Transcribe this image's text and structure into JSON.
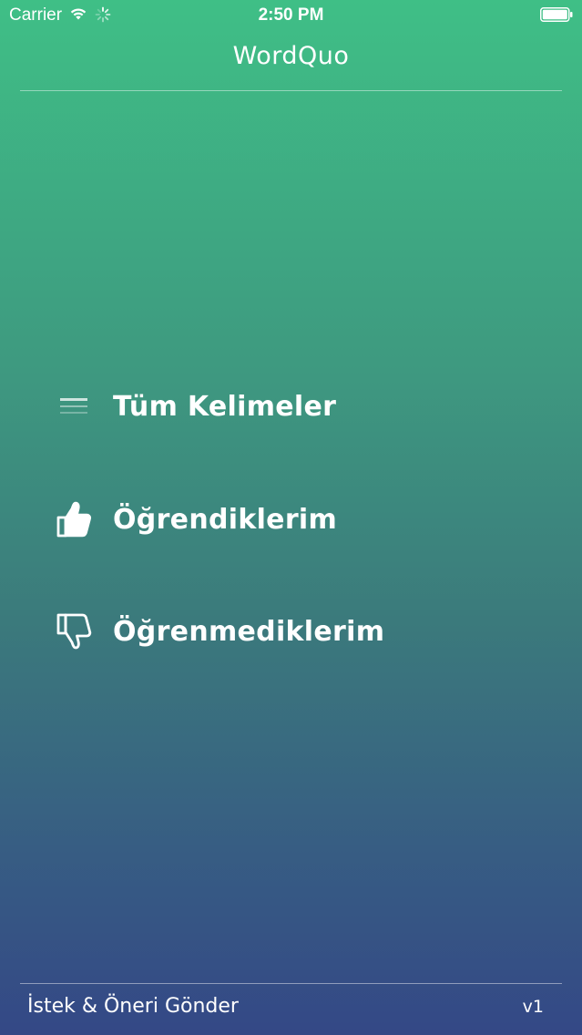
{
  "status_bar": {
    "carrier": "Carrier",
    "time": "2:50 PM",
    "icons": [
      "wifi-icon",
      "spinner-icon",
      "battery-icon"
    ]
  },
  "header": {
    "title": "WordQuo"
  },
  "menu": {
    "items": [
      {
        "label": "Tüm Kelimeler",
        "icon": "list-icon"
      },
      {
        "label": "Öğrendiklerim",
        "icon": "thumbs-up-icon"
      },
      {
        "label": "Öğrenmediklerim",
        "icon": "thumbs-down-icon"
      }
    ]
  },
  "footer": {
    "feedback_label": "İstek & Öneri Gönder",
    "version": "v1"
  },
  "colors": {
    "gradient_top": "#3fbf86",
    "gradient_bottom": "#344886",
    "text": "#ffffff"
  }
}
